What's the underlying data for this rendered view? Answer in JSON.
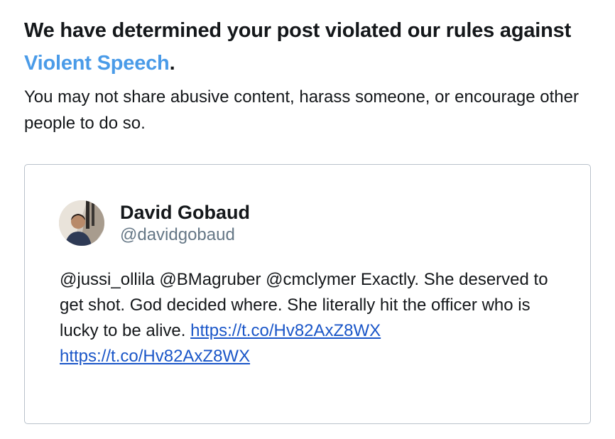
{
  "notice": {
    "headline_prefix": "We have determined your post violated our rules against ",
    "rule_name": "Violent Speech",
    "headline_suffix": ".",
    "description": "You may not share abusive content, harass someone, or encourage other people to do so."
  },
  "tweet": {
    "author_name": "David Gobaud",
    "author_handle": "@davidgobaud",
    "text": "@jussi_ollila @BMagruber @cmclymer Exactly. She deserved to get shot. God decided where. She literally hit the officer who is lucky to be alive.",
    "links": [
      "https://t.co/Hv82AxZ8WX",
      "https://t.co/Hv82AxZ8WX"
    ]
  },
  "colors": {
    "rule_link": "#4a9be8",
    "tweet_link": "#1a56c8",
    "handle_gray": "#657786",
    "card_border": "#b9c2cb"
  }
}
